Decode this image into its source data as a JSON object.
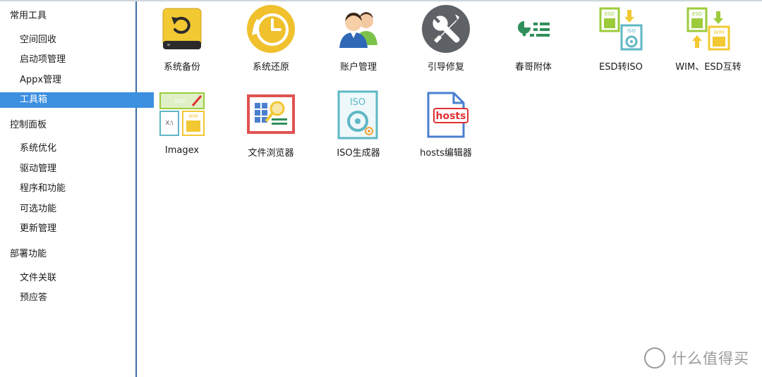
{
  "sidebar": {
    "groups": [
      {
        "label": "常用工具",
        "items": [
          "空间回收",
          "启动项管理",
          "Appx管理",
          "工具箱"
        ]
      },
      {
        "label": "控制面板",
        "items": [
          "系统优化",
          "驱动管理",
          "程序和功能",
          "可选功能",
          "更新管理"
        ]
      },
      {
        "label": "部署功能",
        "items": [
          "文件关联",
          "预应答"
        ]
      }
    ],
    "selected": "工具箱"
  },
  "tools": [
    {
      "label": "系统备份",
      "icon": "drive-backup-icon"
    },
    {
      "label": "系统还原",
      "icon": "clock-restore-icon"
    },
    {
      "label": "账户管理",
      "icon": "users-icon"
    },
    {
      "label": "引导修复",
      "icon": "wrench-screwdriver-icon"
    },
    {
      "label": "春哥附体",
      "icon": "toggle-list-icon"
    },
    {
      "label": "ESD转ISO",
      "icon": "esd-to-iso-icon"
    },
    {
      "label": "WIM、ESD互转",
      "icon": "wim-esd-convert-icon"
    },
    {
      "label": "Imagex",
      "icon": "imagex-icon"
    },
    {
      "label": "文件浏览器",
      "icon": "file-browser-icon"
    },
    {
      "label": "ISO生成器",
      "icon": "iso-generator-icon"
    },
    {
      "label": "hosts编辑器",
      "icon": "hosts-editor-icon"
    }
  ],
  "icon_texts": {
    "iso": "ISO",
    "esd": "ESD",
    "wim": "WIM",
    "hosts": "hosts",
    "x": "X:\\"
  },
  "watermark": {
    "text": "什么值得买",
    "logo": "值"
  },
  "colors": {
    "accent_selected": "#3d8fe0",
    "sidebar_border": "#3b6ea8",
    "green": "#8cc63f",
    "yellow": "#f4c430",
    "red_hosts": "#e03131",
    "teal_iso": "#5fb7c4"
  }
}
